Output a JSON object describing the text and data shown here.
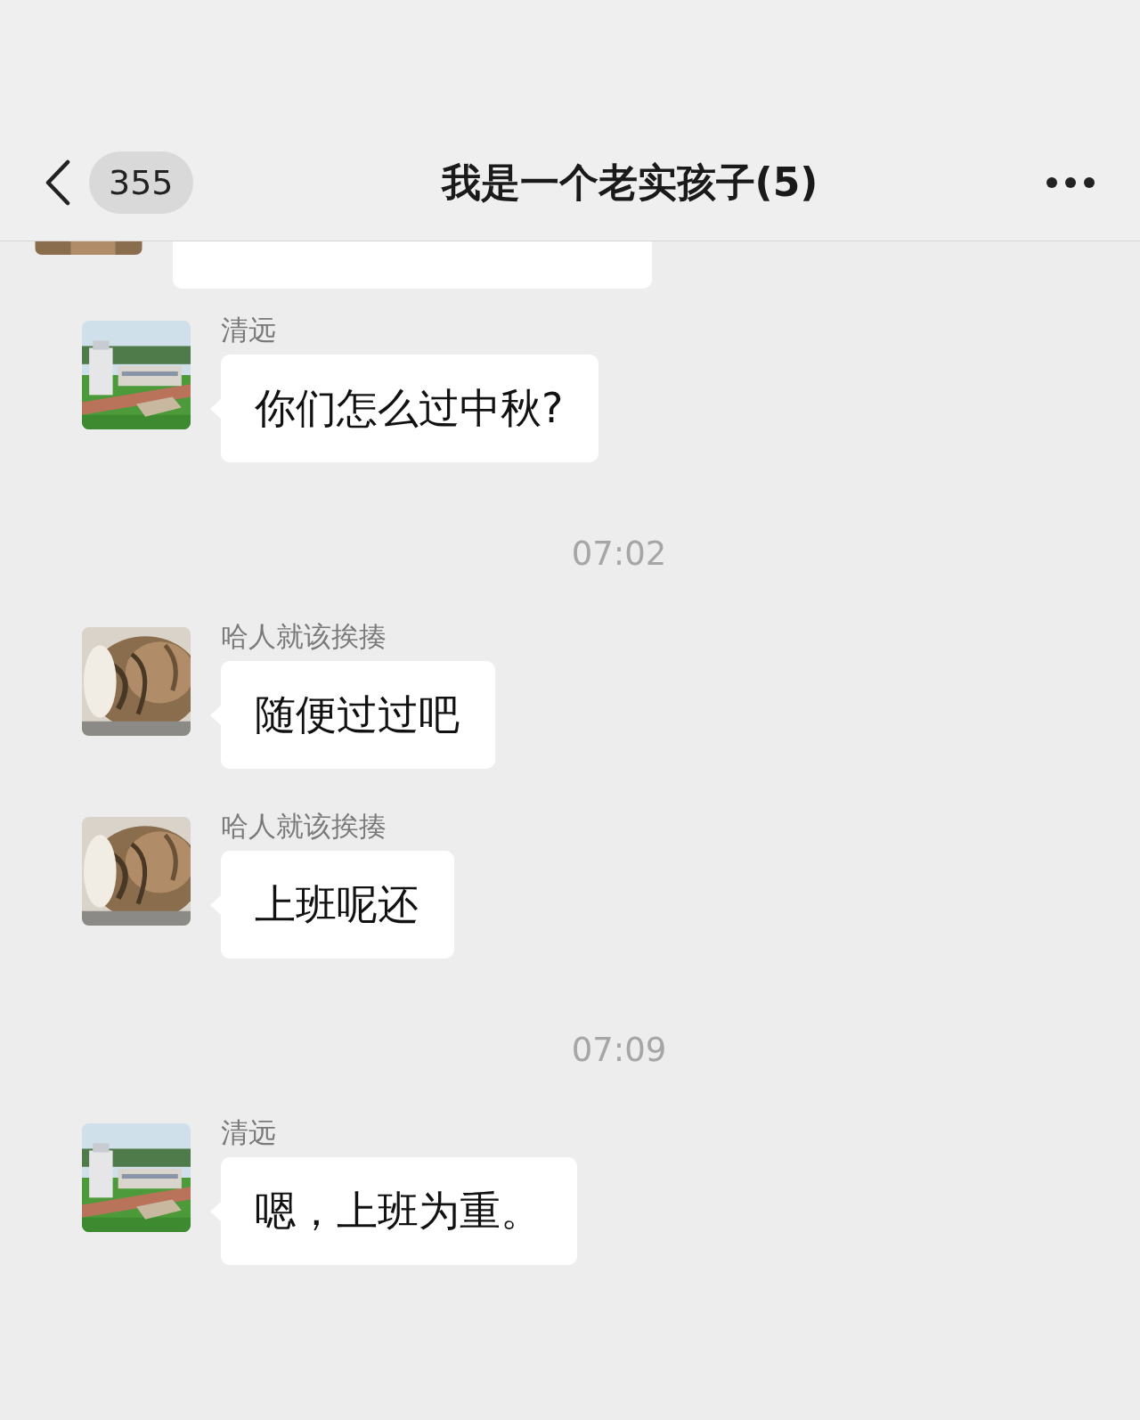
{
  "header": {
    "back_badge": "355",
    "title": "我是一个老实孩子(5)"
  },
  "messages": [
    {
      "kind": "partial"
    },
    {
      "kind": "message",
      "sender": "清远",
      "text": "你们怎么过中秋?"
    },
    {
      "kind": "time",
      "text": "07:02"
    },
    {
      "kind": "message",
      "sender": "哈人就该挨揍",
      "text": "随便过过吧"
    },
    {
      "kind": "message",
      "sender": "哈人就该挨揍",
      "text": "上班呢还"
    },
    {
      "kind": "time",
      "text": "07:09"
    },
    {
      "kind": "message",
      "sender": "清远",
      "text": "嗯，上班为重。"
    }
  ]
}
